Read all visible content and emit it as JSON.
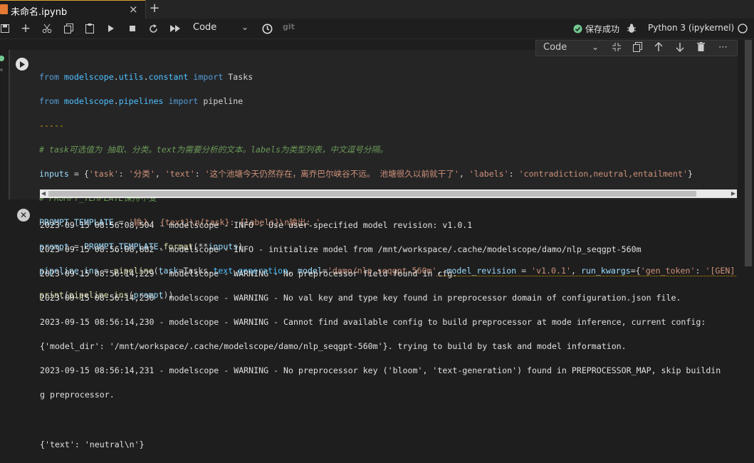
{
  "tab": {
    "title": "未命名.ipynb",
    "close": "×",
    "new": "+"
  },
  "toolbar": {
    "cell_type": "Code",
    "git": "git",
    "status": "保存成功",
    "kernel": "Python 3 (ipykernel)"
  },
  "cell_toolbar": {
    "cell_type": "Code"
  },
  "code_lines": [
    "from modelscope.utils.constant import Tasks",
    "from modelscope.pipelines import pipeline",
    "-----",
    "# task可选值为 抽取、分类。text为需要分析的文本。labels为类型列表，中文逗号分隔。",
    "inputs = {'task': '分类', 'text': '这个池塘今天仍然存在，离乔巴尔峡谷不远。 池塘很久以前就干了', 'labels': 'contradiction,neutral,entailment'}",
    "# PROMPT_TEMPLATE保持不变",
    "PROMPT_TEMPLATE = '输入: {text}\\n{task}: {labels}\\n输出: '",
    "prompt = PROMPT_TEMPLATE.format(**inputs)",
    "pipeline_ins = pipeline(task=Tasks.text_generation, model='damo/nlp_seqgpt-560m', model_revision = 'v1.0.1', run_kwargs={'gen_token': '[GEN]'})",
    "print(pipeline_ins(prompt))"
  ],
  "output_lines": [
    "2023-09-15 08:56:08,504 - modelscope - INFO - Use user-specified model revision: v1.0.1",
    "2023-09-15 08:56:08,882 - modelscope - INFO - initialize model from /mnt/workspace/.cache/modelscope/damo/nlp_seqgpt-560m",
    "2023-09-15 08:56:14,229 - modelscope - WARNING - No preprocessor field found in cfg.",
    "2023-09-15 08:56:14,230 - modelscope - WARNING - No val key and type key found in preprocessor domain of configuration.json file.",
    "2023-09-15 08:56:14,230 - modelscope - WARNING - Cannot find available config to build preprocessor at mode inference, current config:",
    "{'model_dir': '/mnt/workspace/.cache/modelscope/damo/nlp_seqgpt-560m'}. trying to build by task and model information.",
    "2023-09-15 08:56:14,231 - modelscope - WARNING - No preprocessor key ('bloom', 'text-generation') found in PREPROCESSOR_MAP, skip buildin",
    "g preprocessor.",
    "",
    "{'text': 'neutral\\n'}"
  ],
  "colors": {
    "accent_ok": "#73c991",
    "background": "#1e1e1e",
    "cell_bg": "#252526"
  },
  "icons": [
    "save-icon",
    "add-icon",
    "cut-icon",
    "copy-icon",
    "paste-icon",
    "run-icon",
    "stop-icon",
    "restart-icon",
    "run-all-icon",
    "clock-icon",
    "check-circle-icon",
    "debug-icon",
    "kernel-idle-icon"
  ]
}
